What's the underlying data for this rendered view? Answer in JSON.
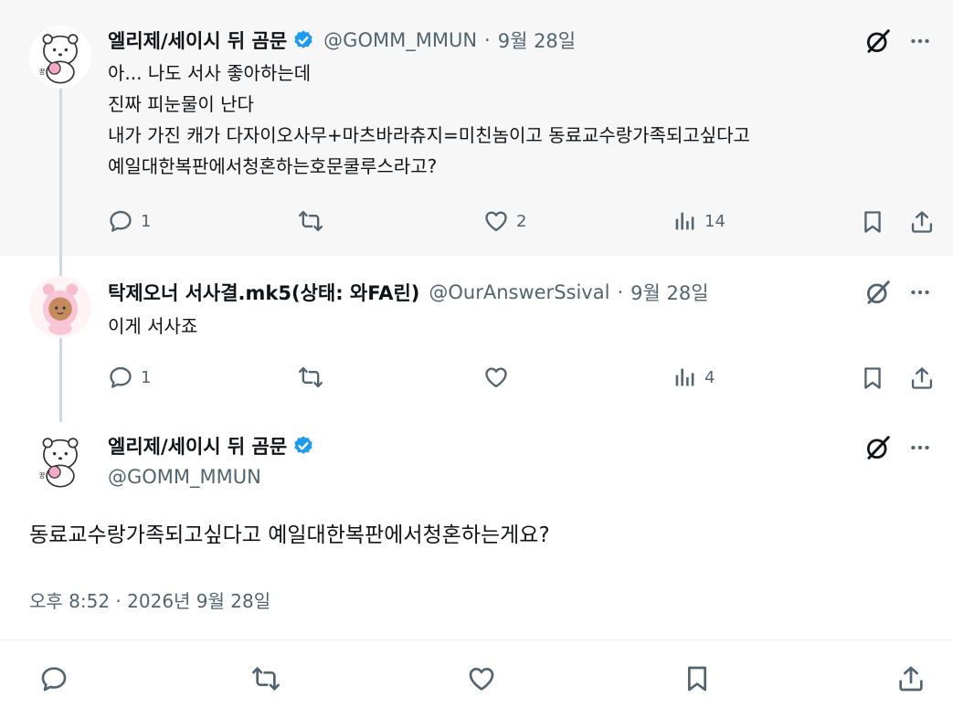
{
  "tweets": [
    {
      "author_name": "엘리제/세이시 뒤 곰문",
      "verified": true,
      "handle": "@GOMM_MMUN",
      "date": "9월 28일",
      "lines": [
        "아... 나도 서사 좋아하는데",
        "진짜 피눈물이 난다",
        "내가 가진 캐가 다자이오사무+마츠바라츄지=미친놈이고 동료교수랑가족되고싶다고",
        "예일대한복판에서청혼하는호문쿨루스라고?"
      ],
      "replies": "1",
      "retweets": "",
      "likes": "2",
      "views": "14"
    },
    {
      "author_name": "탁제오너 서사결.mk5(상태: 와FA린)",
      "verified": false,
      "handle": "@OurAnswerSsival",
      "date": "9월 28일",
      "lines": [
        "이게 서사죠"
      ],
      "replies": "1",
      "retweets": "",
      "likes": "",
      "views": "4"
    }
  ],
  "main_tweet": {
    "author_name": "엘리제/세이시 뒤 곰문",
    "verified": true,
    "handle": "@GOMM_MMUN",
    "text": "동료교수랑가족되고싶다고 예일대한복판에서청혼하는게요?",
    "timestamp": "오후 8:52 · 2026년 9월 28일"
  },
  "separator": "·",
  "colors": {
    "accent": "#1d9bf0",
    "secondary_text": "#536471",
    "highlight_bg": "#f7f7f7"
  },
  "icons": [
    "grok-icon",
    "more-icon",
    "reply-icon",
    "retweet-icon",
    "like-icon",
    "views-icon",
    "bookmark-icon",
    "share-icon",
    "verified-badge-icon"
  ]
}
